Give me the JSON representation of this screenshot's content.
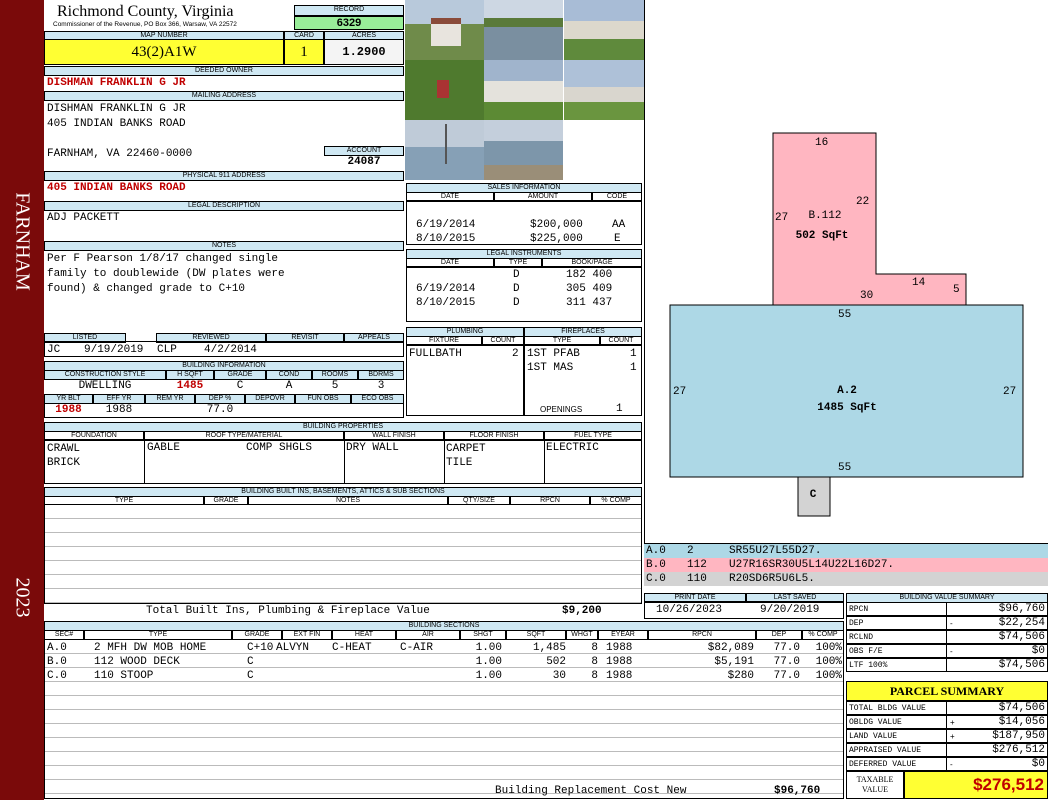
{
  "side": {
    "town": "FARNHAM",
    "year": "2023"
  },
  "header": {
    "county": "Richmond County, Virginia",
    "commissioner": "Commissioner of the Revenue, PO Box 366, Warsaw, VA 22572",
    "record_label": "RECORD",
    "record": "6329",
    "map_label": "MAP NUMBER",
    "map": "43(2)A1W",
    "card_label": "CARD",
    "card": "1",
    "acres_label": "ACRES",
    "acres": "1.2900"
  },
  "owner": {
    "deeded_label": "DEEDED OWNER",
    "deeded": "DISHMAN FRANKLIN G JR",
    "mailing_label": "MAILING ADDRESS",
    "line1": "DISHMAN FRANKLIN G JR",
    "line2": "405 INDIAN BANKS ROAD",
    "line3": "FARNHAM, VA 22460-0000",
    "account_label": "ACCOUNT",
    "account": "24087",
    "physical_label": "PHYSICAL 911 ADDRESS",
    "physical": "405 INDIAN BANKS ROAD"
  },
  "legal": {
    "label": "LEGAL DESCRIPTION",
    "text": "ADJ PACKETT"
  },
  "notes": {
    "label": "NOTES",
    "text": "Per F Pearson 1/8/17 changed single\nfamily to doublewide (DW plates were\nfound) & changed grade to C+10"
  },
  "listing": {
    "listed_label": "LISTED",
    "reviewed_label": "REVIEWED",
    "revisit_label": "REVISIT",
    "appeals_label": "APPEALS",
    "listed_by": "JC",
    "listed_date": "9/19/2019",
    "reviewed_by": "CLP",
    "reviewed_date": "4/2/2014"
  },
  "bldg_info": {
    "label": "BUILDING INFORMATION",
    "h": [
      "CONSTRUCTION STYLE",
      "H SQFT",
      "GRADE",
      "COND",
      "ROOMS",
      "BDRMS"
    ],
    "v": [
      "DWELLING",
      "1485",
      "C",
      "A",
      "5",
      "3"
    ],
    "h2": [
      "YR BLT",
      "EFF YR",
      "REM YR",
      "DEP %",
      "DEPOVR",
      "FUN OBS",
      "ECO OBS"
    ],
    "v2": [
      "1988",
      "1988",
      "",
      "77.0",
      "",
      "",
      ""
    ]
  },
  "props": {
    "label": "BUILDING PROPERTIES",
    "h": [
      "FOUNDATION",
      "ROOF TYPE/MATERIAL",
      "WALL FINISH",
      "FLOOR FINISH",
      "FUEL TYPE"
    ],
    "foundation": "CRAWL\nBRICK",
    "roof1": "GABLE",
    "roof2": "COMP SHGLS",
    "wall": "DRY WALL",
    "floor": "CARPET\nTILE",
    "fuel": "ELECTRIC"
  },
  "builtins": {
    "label": "BUILDING BUILT INS, BASEMENTS, ATTICS & SUB SECTIONS",
    "h": [
      "TYPE",
      "GRADE",
      "NOTES",
      "QTY/SIZE",
      "RPCN",
      "% COMP"
    ],
    "total_label": "Total Built Ins, Plumbing & Fireplace Value",
    "total": "$9,200"
  },
  "sales": {
    "label": "SALES INFORMATION",
    "h": [
      "DATE",
      "AMOUNT",
      "CODE"
    ],
    "rows": [
      [
        "6/19/2014",
        "$200,000",
        "AA"
      ],
      [
        "8/10/2015",
        "$225,000",
        "E"
      ]
    ]
  },
  "instruments": {
    "label": "LEGAL INSTRUMENTS",
    "h": [
      "DATE",
      "TYPE",
      "BOOK/PAGE"
    ],
    "rows": [
      [
        "",
        "D",
        "182 400"
      ],
      [
        "6/19/2014",
        "D",
        "305 409"
      ],
      [
        "8/10/2015",
        "D",
        "311 437"
      ]
    ]
  },
  "plumbing": {
    "label": "PLUMBING",
    "h": [
      "FIXTURE",
      "COUNT"
    ],
    "rows": [
      [
        "FULLBATH",
        "2"
      ]
    ]
  },
  "fireplaces": {
    "label": "FIREPLACES",
    "h": [
      "TYPE",
      "COUNT"
    ],
    "rows": [
      [
        "1ST PFAB",
        "1"
      ],
      [
        "1ST MAS",
        "1"
      ]
    ],
    "openings_label": "OPENINGS",
    "openings": "1"
  },
  "sketch": {
    "b_label": "B.112",
    "b_area": "502 SqFt",
    "a_label": "A.2",
    "a_area": "1485 SqFt",
    "c_label": "C",
    "dims": [
      "16",
      "22",
      "27",
      "14",
      "5",
      "30",
      "55",
      "27",
      "27",
      "55"
    ]
  },
  "sketch_codes": [
    {
      "code": "A.0",
      "n": "2",
      "path": "SR55U27L55D27.",
      "color": "#add8e6"
    },
    {
      "code": "B.0",
      "n": "112",
      "path": "U27R16SR30U5L14U22L16D27.",
      "color": "#ffb6c1"
    },
    {
      "code": "C.0",
      "n": "110",
      "path": "R20SD6R5U6L5.",
      "color": "#d3d3d3"
    }
  ],
  "dates": {
    "print_label": "PRINT DATE",
    "print": "10/26/2023",
    "saved_label": "LAST SAVED",
    "saved": "9/20/2019"
  },
  "value_summary": {
    "label": "BUILDING VALUE SUMMARY",
    "rows": [
      [
        "RPCN",
        "",
        "$96,760"
      ],
      [
        "DEP",
        "-",
        "$22,254"
      ],
      [
        "RCLND",
        "",
        "$74,506"
      ],
      [
        "OBS F/E",
        "-",
        "$0"
      ],
      [
        "LTF 100%",
        "",
        "$74,506"
      ]
    ]
  },
  "parcel": {
    "label": "PARCEL SUMMARY",
    "rows": [
      [
        "TOTAL BLDG VALUE",
        "",
        "$74,506"
      ],
      [
        "OBLDG VALUE",
        "+",
        "$14,056"
      ],
      [
        "LAND VALUE",
        "+",
        "$187,950"
      ],
      [
        "APPRAISED VALUE",
        "",
        "$276,512"
      ],
      [
        "DEFERRED VALUE",
        "-",
        "$0"
      ]
    ],
    "taxable_label1": "TAXABLE",
    "taxable_label2": "VALUE",
    "taxable": "$276,512"
  },
  "sections": {
    "label": "BUILDING SECTIONS",
    "h": [
      "SEC#",
      "TYPE",
      "GRADE",
      "EXT FIN",
      "HEAT",
      "AIR",
      "SHGT",
      "SQFT",
      "WHGT",
      "EYEAR",
      "RPCN",
      "DEP",
      "% COMP"
    ],
    "rows": [
      [
        "A.0",
        "2 MFH DW MOB HOME",
        "C+10",
        "ALVYN",
        "C-HEAT",
        "C-AIR",
        "1.00",
        "1,485",
        "8",
        "1988",
        "$82,089",
        "77.0",
        "100%"
      ],
      [
        "B.0",
        "112 WOOD DECK",
        "C",
        "",
        "",
        "",
        "1.00",
        "502",
        "8",
        "1988",
        "$5,191",
        "77.0",
        "100%"
      ],
      [
        "C.0",
        "110 STOOP",
        "C",
        "",
        "",
        "",
        "1.00",
        "30",
        "8",
        "1988",
        "$280",
        "77.0",
        "100%"
      ]
    ],
    "rcn_label": "Building Replacement Cost New",
    "rcn": "$96,760"
  },
  "colors": {
    "band": "#7a0a0a",
    "label_bg": "#cfe8f3",
    "yellow": "#ffff33",
    "green": "#99ee99",
    "pink": "#ffb6c1",
    "blue": "#add8e6",
    "gray": "#d3d3d3"
  }
}
